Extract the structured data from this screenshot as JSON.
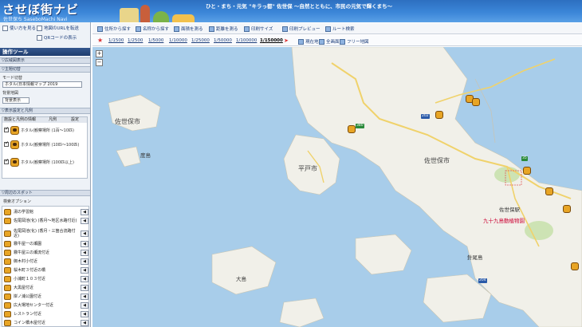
{
  "header": {
    "logo": "させぼ街ナビ",
    "subtitle": "佐世保ち SaseboMachi Navi",
    "tagline": "ひと・まち・元気 \"キラっ都\" 佐世保 ～自然とともに、市民の元気で輝くまち～"
  },
  "left": {
    "help_label": "使い方を見る",
    "url_label": "地図のURLを転送",
    "qr_label": "QRコードの表示",
    "tool_title": "操作ツール",
    "section_wide": "▽広域図表示",
    "section_theme": "▽主題切替",
    "theme_mode_label": "モード切替",
    "theme_select": "ホタル(日本情報マップ 2019",
    "scale_label": "背景地図",
    "bg_select": "背景表示",
    "section_layers": "▽表示設定と凡例",
    "layer_col_name": "施設と凡例の情報",
    "layer_col_a": "凡例",
    "layer_col_b": "設定",
    "layers": [
      {
        "label": "ホタル(観察場所 (1百～10匹)"
      },
      {
        "label": "ホタル(観察場所 (10匹～100匹)"
      },
      {
        "label": "ホタル(観察場所 (100匹以上)"
      }
    ],
    "section_spots": "▽周辺のスポット",
    "search_option": "検索オプション",
    "spots": [
      {
        "name": "湯の学習館"
      },
      {
        "name": "佐尾岡池(化) (香月～地区水路付近)"
      },
      {
        "name": "佐尾岡池(化) (香月・三箇合流路付近)"
      },
      {
        "name": "霧牛屋一の瀬園"
      },
      {
        "name": "霧牛屋三の瀬流付近"
      },
      {
        "name": "御木村小付近"
      },
      {
        "name": "桜木町３付近の橋"
      },
      {
        "name": "小浦町１０３付近"
      },
      {
        "name": "大黒屋付近"
      },
      {
        "name": "岸ノ浦公園付近"
      },
      {
        "name": "広大場地センター付近"
      },
      {
        "name": "レストラン付近"
      },
      {
        "name": "コイン橋木屋付近"
      }
    ]
  },
  "toolbar": {
    "items": [
      "住所から探す",
      "名称から探す",
      "面積を測る",
      "距離を測る",
      "印刷サイズ",
      "印刷プレビュー",
      "ルート検索"
    ],
    "scales": [
      "1/1500",
      "1/2500",
      "1/5000",
      "1/10000",
      "1/25000",
      "1/50000",
      "1/100000",
      "1/150000"
    ],
    "active_scale": "1/150000",
    "sub_items": [
      "現在地",
      "全画面",
      "フリー地図"
    ]
  },
  "map": {
    "labels": [
      "佐世保市",
      "平戸市",
      "佐世保市",
      "佐世保駅",
      "九十九島動植物園",
      "針尾島",
      "大島",
      "度島"
    ],
    "shields": [
      "380",
      "202",
      "35",
      "204"
    ],
    "zoom_in": "+",
    "zoom_out": "−",
    "colors": {
      "sea": "#a8cdea",
      "land": "#f1f0e9",
      "road": "#f0d26b"
    }
  }
}
